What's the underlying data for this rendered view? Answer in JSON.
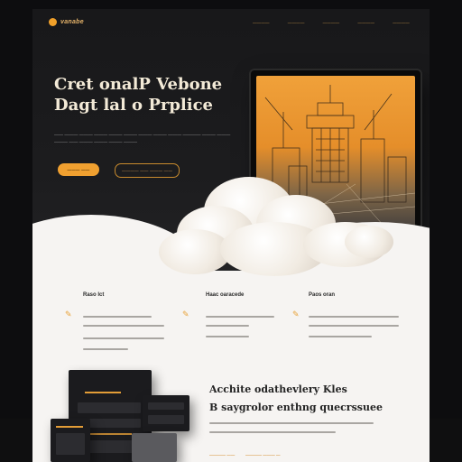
{
  "brand": {
    "name": "vanabe"
  },
  "nav": {
    "items": [
      "————",
      "————",
      "————",
      "————",
      "————"
    ]
  },
  "hero": {
    "title_line1": "Cret onalP Vebone",
    "title_line2": "Dagt lal o Prplice",
    "subtitle": "—— ——— ——— ——— ——— ——— ——— ——— ——— ———— ——— ——— ——— —— ——— ——— ——— ———",
    "primary_button": "——— ——",
    "secondary_button": "———— —— ——— ——"
  },
  "features": [
    {
      "title": "Raso Ict",
      "icon": "pencil-icon"
    },
    {
      "title": "Haac oaracede",
      "icon": "pencil-icon"
    },
    {
      "title": "Paos oran",
      "icon": "pencil-icon"
    }
  ],
  "section2": {
    "title_line1": "Acchite odathevlery Kles",
    "title_line2": "B saygrolor enthng quecrssuee",
    "cta_primary": "———— ——",
    "cta_secondary": "———— ——— —"
  },
  "colors": {
    "accent": "#f0a030",
    "hero_bg": "#1c1c1e",
    "page_bg": "#f6f4f2"
  }
}
